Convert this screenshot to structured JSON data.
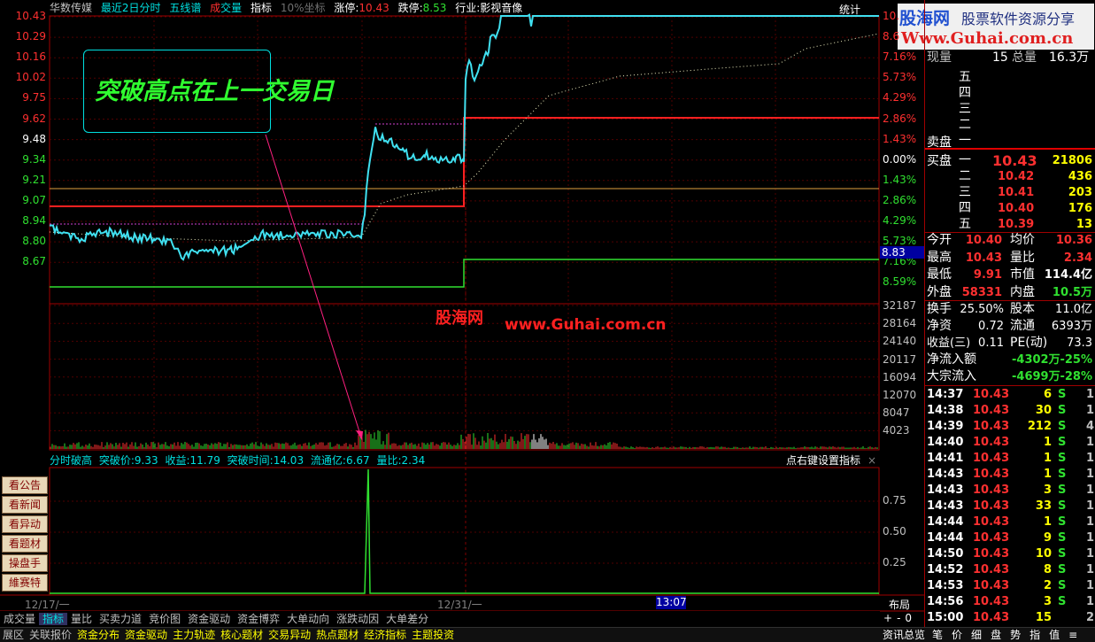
{
  "header": {
    "stock_name": "华数传媒",
    "period": "最近2日分时",
    "wulian": "五线谱",
    "chengjiao_a": "成",
    "chengjiao_b": "交量",
    "indicator": "指标",
    "coord": "10%坐标",
    "up_limit_label": "涨停:",
    "up_limit": "10.43",
    "down_limit_label": "跌停:",
    "down_limit": "8.53",
    "industry": "行业:影视音像",
    "stats": "统计"
  },
  "watermark": {
    "site": "股海网",
    "slogan": "股票软件资源分享",
    "url": "Www.Guhai.com.cn",
    "mid_cn": "股海网",
    "mid_url": "www.Guhai.com.cn"
  },
  "callout": "突破高点在上一交易日",
  "price_axis_left": [
    "10.43",
    "10.29",
    "10.16",
    "10.02",
    "9.75",
    "9.62",
    "9.48",
    "9.34",
    "9.21",
    "9.07",
    "8.94",
    "8.80",
    "8.67"
  ],
  "pct_axis_right": [
    "10.",
    "8.6",
    "7.16%",
    "5.73%",
    "4.29%",
    "2.86%",
    "1.43%",
    "0.00%",
    "1.43%",
    "2.86%",
    "4.29%",
    "5.73%",
    "7.16%",
    "8.59%"
  ],
  "cursor_price": "8.83",
  "vol_axis": [
    "32187",
    "28164",
    "24140",
    "20117",
    "16094",
    "12070",
    "8047",
    "4023"
  ],
  "sub_header": {
    "name": "分时破高",
    "break_price_label": "突破价:",
    "break_price": "9.33",
    "income_label": "收益:",
    "income": "11.79",
    "break_time_label": "突破时间:",
    "break_time": "14.03",
    "float_label": "流通亿:",
    "float": "6.67",
    "ratio_label": "量比:",
    "ratio": "2.34",
    "hint": "点右键设置指标",
    "close": "×"
  },
  "ind_axis": [
    "0.75",
    "0.50",
    "0.25"
  ],
  "left_buttons": [
    "看公告",
    "看新闻",
    "看异动",
    "看题材",
    "操盘手",
    "維赛特"
  ],
  "date_axis": {
    "d1": "12/17/一",
    "d2": "12/31/一",
    "cursor_time": "13:07",
    "layout": "布局"
  },
  "zoom": {
    "plus": "+",
    "minus": "-",
    "zero": "0"
  },
  "tabs1": [
    "成交量",
    "指标",
    "量比",
    "买卖力道",
    "竞价图",
    "资金驱动",
    "资金博弈",
    "大单动向",
    "涨跌动因",
    "大单差分"
  ],
  "tabs2": [
    "展区",
    "关联报价",
    "资金分布",
    "资金驱动",
    "主力轨迹",
    "核心题材",
    "交易异动",
    "热点题材",
    "经济指标",
    "主题投资"
  ],
  "rp_top": {
    "now_label": "现量",
    "now_val": "15",
    "total_label": "总量",
    "total_val": "16.3万"
  },
  "sell": {
    "label": "卖盘",
    "levels": [
      "五",
      "四",
      "三",
      "二",
      "一"
    ]
  },
  "buy": {
    "label": "买盘",
    "rows": [
      {
        "lvl": "一",
        "price": "10.43",
        "vol": "21806"
      },
      {
        "lvl": "二",
        "price": "10.42",
        "vol": "436"
      },
      {
        "lvl": "三",
        "price": "10.41",
        "vol": "203"
      },
      {
        "lvl": "四",
        "price": "10.40",
        "vol": "176"
      },
      {
        "lvl": "五",
        "price": "10.39",
        "vol": "13"
      }
    ]
  },
  "quote": [
    {
      "l1": "今开",
      "v1": "10.40",
      "c1": "#ff3030",
      "l2": "均价",
      "v2": "10.36",
      "c2": "#ff3030"
    },
    {
      "l1": "最高",
      "v1": "10.43",
      "c1": "#ff3030",
      "l2": "量比",
      "v2": "2.34",
      "c2": "#ff3030"
    },
    {
      "l1": "最低",
      "v1": "9.91",
      "c1": "#ff3030",
      "l2": "市值",
      "v2": "114.4亿",
      "c2": "#ffffff"
    },
    {
      "l1": "外盘",
      "v1": "58331",
      "c1": "#ff3030",
      "l2": "内盘",
      "v2": "10.5万",
      "c2": "#30e030"
    }
  ],
  "fund": [
    {
      "l1": "换手",
      "v1": "25.50%",
      "l2": "股本",
      "v2": "11.0亿"
    },
    {
      "l1": "净资",
      "v1": "0.72",
      "l2": "流通",
      "v2": "6393万"
    },
    {
      "l1": "收益(三)",
      "v1": "0.11",
      "l2": "PE(动)",
      "v2": "73.3"
    }
  ],
  "flow": [
    {
      "label": "净流入额",
      "val": "-4302万",
      "pct": "-25%"
    },
    {
      "label": "大宗流入",
      "val": "-4699万",
      "pct": "-28%"
    }
  ],
  "ticks": [
    {
      "t": "14:37",
      "p": "10.43",
      "v": "6",
      "s": "S",
      "n": "1"
    },
    {
      "t": "14:38",
      "p": "10.43",
      "v": "30",
      "s": "S",
      "n": "1"
    },
    {
      "t": "14:39",
      "p": "10.43",
      "v": "212",
      "s": "S",
      "n": "4"
    },
    {
      "t": "14:40",
      "p": "10.43",
      "v": "1",
      "s": "S",
      "n": "1"
    },
    {
      "t": "14:41",
      "p": "10.43",
      "v": "1",
      "s": "S",
      "n": "1"
    },
    {
      "t": "14:43",
      "p": "10.43",
      "v": "1",
      "s": "S",
      "n": "1"
    },
    {
      "t": "14:43",
      "p": "10.43",
      "v": "3",
      "s": "S",
      "n": "1"
    },
    {
      "t": "14:43",
      "p": "10.43",
      "v": "33",
      "s": "S",
      "n": "1"
    },
    {
      "t": "14:44",
      "p": "10.43",
      "v": "1",
      "s": "S",
      "n": "1"
    },
    {
      "t": "14:44",
      "p": "10.43",
      "v": "9",
      "s": "S",
      "n": "1"
    },
    {
      "t": "14:50",
      "p": "10.43",
      "v": "10",
      "s": "S",
      "n": "1"
    },
    {
      "t": "14:52",
      "p": "10.43",
      "v": "8",
      "s": "S",
      "n": "1"
    },
    {
      "t": "14:53",
      "p": "10.43",
      "v": "2",
      "s": "S",
      "n": "1"
    },
    {
      "t": "14:56",
      "p": "10.43",
      "v": "3",
      "s": "S",
      "n": "1"
    },
    {
      "t": "15:00",
      "p": "10.43",
      "v": "15",
      "s": "",
      "n": "2"
    }
  ],
  "rp_bottom": [
    "资讯总览",
    "笔",
    "价",
    "细",
    "盘",
    "势",
    "指",
    "值",
    "≡"
  ]
}
